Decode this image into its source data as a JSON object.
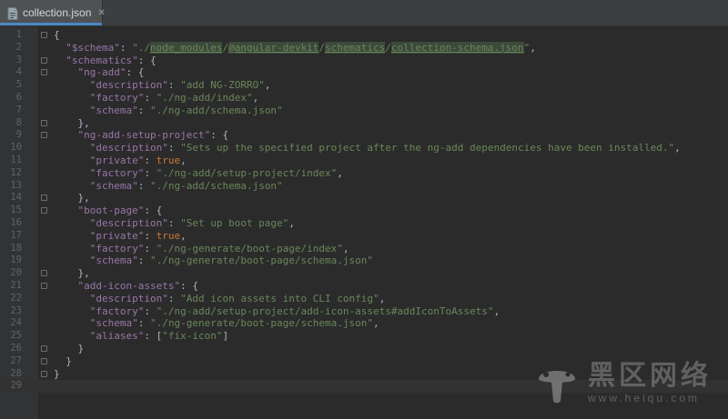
{
  "tab": {
    "label": "collection.json",
    "close_glyph": "✕",
    "icon": "json-file-icon"
  },
  "editor": {
    "current_line": 29,
    "lines": [
      {
        "n": "1",
        "tokens": [
          {
            "t": "p",
            "v": "{"
          }
        ]
      },
      {
        "n": "2",
        "tokens": [
          {
            "t": "p",
            "v": "  "
          },
          {
            "t": "k",
            "v": "\"$schema\""
          },
          {
            "t": "p",
            "v": ": "
          },
          {
            "t": "s",
            "v": "\"./"
          },
          {
            "t": "sh",
            "v": "node_modules"
          },
          {
            "t": "s",
            "v": "/"
          },
          {
            "t": "sh",
            "v": "@angular-devkit"
          },
          {
            "t": "s",
            "v": "/"
          },
          {
            "t": "sh",
            "v": "schematics"
          },
          {
            "t": "s",
            "v": "/"
          },
          {
            "t": "sh",
            "v": "collection-schema.json"
          },
          {
            "t": "s",
            "v": "\""
          },
          {
            "t": "p",
            "v": ","
          }
        ]
      },
      {
        "n": "3",
        "tokens": [
          {
            "t": "p",
            "v": "  "
          },
          {
            "t": "k",
            "v": "\"schematics\""
          },
          {
            "t": "p",
            "v": ": {"
          }
        ]
      },
      {
        "n": "4",
        "tokens": [
          {
            "t": "p",
            "v": "    "
          },
          {
            "t": "k",
            "v": "\"ng-add\""
          },
          {
            "t": "p",
            "v": ": {"
          }
        ]
      },
      {
        "n": "5",
        "tokens": [
          {
            "t": "p",
            "v": "      "
          },
          {
            "t": "k",
            "v": "\"description\""
          },
          {
            "t": "p",
            "v": ": "
          },
          {
            "t": "s",
            "v": "\"add NG-ZORRO\""
          },
          {
            "t": "p",
            "v": ","
          }
        ]
      },
      {
        "n": "6",
        "tokens": [
          {
            "t": "p",
            "v": "      "
          },
          {
            "t": "k",
            "v": "\"factory\""
          },
          {
            "t": "p",
            "v": ": "
          },
          {
            "t": "s",
            "v": "\"./ng-add/index\""
          },
          {
            "t": "p",
            "v": ","
          }
        ]
      },
      {
        "n": "7",
        "tokens": [
          {
            "t": "p",
            "v": "      "
          },
          {
            "t": "k",
            "v": "\"schema\""
          },
          {
            "t": "p",
            "v": ": "
          },
          {
            "t": "s",
            "v": "\"./ng-add/schema.json\""
          }
        ]
      },
      {
        "n": "8",
        "tokens": [
          {
            "t": "p",
            "v": "    },"
          }
        ]
      },
      {
        "n": "9",
        "tokens": [
          {
            "t": "p",
            "v": "    "
          },
          {
            "t": "k",
            "v": "\"ng-add-setup-project\""
          },
          {
            "t": "p",
            "v": ": {"
          }
        ]
      },
      {
        "n": "10",
        "tokens": [
          {
            "t": "p",
            "v": "      "
          },
          {
            "t": "k",
            "v": "\"description\""
          },
          {
            "t": "p",
            "v": ": "
          },
          {
            "t": "s",
            "v": "\"Sets up the specified project after the ng-add dependencies have been installed.\""
          },
          {
            "t": "p",
            "v": ","
          }
        ]
      },
      {
        "n": "11",
        "tokens": [
          {
            "t": "p",
            "v": "      "
          },
          {
            "t": "k",
            "v": "\"private\""
          },
          {
            "t": "p",
            "v": ": "
          },
          {
            "t": "kw",
            "v": "true"
          },
          {
            "t": "p",
            "v": ","
          }
        ]
      },
      {
        "n": "12",
        "tokens": [
          {
            "t": "p",
            "v": "      "
          },
          {
            "t": "k",
            "v": "\"factory\""
          },
          {
            "t": "p",
            "v": ": "
          },
          {
            "t": "s",
            "v": "\"./ng-add/setup-project/index\""
          },
          {
            "t": "p",
            "v": ","
          }
        ]
      },
      {
        "n": "13",
        "tokens": [
          {
            "t": "p",
            "v": "      "
          },
          {
            "t": "k",
            "v": "\"schema\""
          },
          {
            "t": "p",
            "v": ": "
          },
          {
            "t": "s",
            "v": "\"./ng-add/schema.json\""
          }
        ]
      },
      {
        "n": "14",
        "tokens": [
          {
            "t": "p",
            "v": "    },"
          }
        ]
      },
      {
        "n": "15",
        "tokens": [
          {
            "t": "p",
            "v": "    "
          },
          {
            "t": "k",
            "v": "\"boot-page\""
          },
          {
            "t": "p",
            "v": ": {"
          }
        ]
      },
      {
        "n": "16",
        "tokens": [
          {
            "t": "p",
            "v": "      "
          },
          {
            "t": "k",
            "v": "\"description\""
          },
          {
            "t": "p",
            "v": ": "
          },
          {
            "t": "s",
            "v": "\"Set up boot page\""
          },
          {
            "t": "p",
            "v": ","
          }
        ]
      },
      {
        "n": "17",
        "tokens": [
          {
            "t": "p",
            "v": "      "
          },
          {
            "t": "k",
            "v": "\"private\""
          },
          {
            "t": "p",
            "v": ": "
          },
          {
            "t": "kw",
            "v": "true"
          },
          {
            "t": "p",
            "v": ","
          }
        ]
      },
      {
        "n": "18",
        "tokens": [
          {
            "t": "p",
            "v": "      "
          },
          {
            "t": "k",
            "v": "\"factory\""
          },
          {
            "t": "p",
            "v": ": "
          },
          {
            "t": "s",
            "v": "\"./ng-generate/boot-page/index\""
          },
          {
            "t": "p",
            "v": ","
          }
        ]
      },
      {
        "n": "19",
        "tokens": [
          {
            "t": "p",
            "v": "      "
          },
          {
            "t": "k",
            "v": "\"schema\""
          },
          {
            "t": "p",
            "v": ": "
          },
          {
            "t": "s",
            "v": "\"./ng-generate/boot-page/schema.json\""
          }
        ]
      },
      {
        "n": "20",
        "tokens": [
          {
            "t": "p",
            "v": "    },"
          }
        ]
      },
      {
        "n": "21",
        "tokens": [
          {
            "t": "p",
            "v": "    "
          },
          {
            "t": "k",
            "v": "\"add-icon-assets\""
          },
          {
            "t": "p",
            "v": ": {"
          }
        ]
      },
      {
        "n": "22",
        "tokens": [
          {
            "t": "p",
            "v": "      "
          },
          {
            "t": "k",
            "v": "\"description\""
          },
          {
            "t": "p",
            "v": ": "
          },
          {
            "t": "s",
            "v": "\"Add icon assets into CLI config\""
          },
          {
            "t": "p",
            "v": ","
          }
        ]
      },
      {
        "n": "23",
        "tokens": [
          {
            "t": "p",
            "v": "      "
          },
          {
            "t": "k",
            "v": "\"factory\""
          },
          {
            "t": "p",
            "v": ": "
          },
          {
            "t": "s",
            "v": "\"./ng-add/setup-project/add-icon-assets#addIconToAssets\""
          },
          {
            "t": "p",
            "v": ","
          }
        ]
      },
      {
        "n": "24",
        "tokens": [
          {
            "t": "p",
            "v": "      "
          },
          {
            "t": "k",
            "v": "\"schema\""
          },
          {
            "t": "p",
            "v": ": "
          },
          {
            "t": "s",
            "v": "\"./ng-generate/boot-page/schema.json\""
          },
          {
            "t": "p",
            "v": ","
          }
        ]
      },
      {
        "n": "25",
        "tokens": [
          {
            "t": "p",
            "v": "      "
          },
          {
            "t": "k",
            "v": "\"aliases\""
          },
          {
            "t": "p",
            "v": ": ["
          },
          {
            "t": "s",
            "v": "\"fix-icon\""
          },
          {
            "t": "p",
            "v": "]"
          }
        ]
      },
      {
        "n": "26",
        "tokens": [
          {
            "t": "p",
            "v": "    }"
          }
        ]
      },
      {
        "n": "27",
        "tokens": [
          {
            "t": "p",
            "v": "  }"
          }
        ]
      },
      {
        "n": "28",
        "tokens": [
          {
            "t": "p",
            "v": "}"
          }
        ]
      },
      {
        "n": "29",
        "tokens": []
      }
    ],
    "fold_lines": [
      "1",
      "3",
      "4",
      "8",
      "9",
      "14",
      "15",
      "20",
      "21",
      "26",
      "27",
      "28"
    ]
  },
  "watermark": {
    "cn": "黑区网络",
    "url": "www.heiqu.com"
  },
  "colors": {
    "background": "#2b2b2b",
    "key": "#9876aa",
    "string": "#6a8759",
    "keyword": "#cc7832",
    "punctuation": "#a9b7c6",
    "tab_accent": "#4a88c7"
  }
}
